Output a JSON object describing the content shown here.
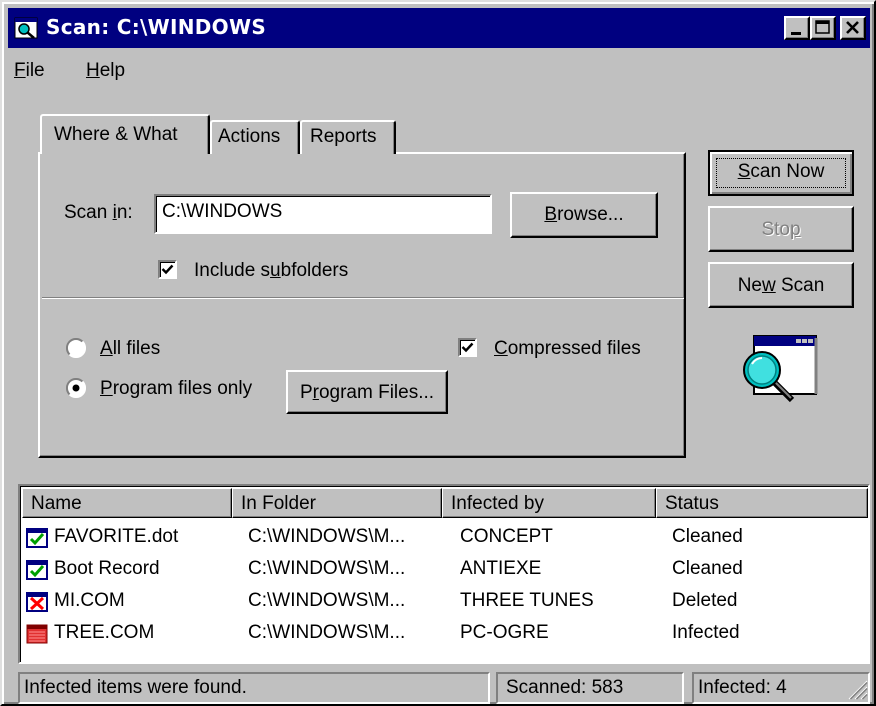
{
  "window": {
    "title": "Scan: C:\\WINDOWS",
    "minimize_icon": "minimize-icon",
    "maximize_icon": "maximize-icon",
    "close_icon": "close-icon"
  },
  "menu": {
    "items": [
      {
        "label_mnemonic": "F",
        "label_rest": "ile"
      },
      {
        "label_mnemonic": "H",
        "label_rest": "elp"
      }
    ]
  },
  "tabs": [
    {
      "label": "Where & What",
      "active": true
    },
    {
      "label": "Actions",
      "active": false
    },
    {
      "label": "Reports",
      "active": false
    }
  ],
  "where_what": {
    "scan_in_label_a": "Scan ",
    "scan_in_label_mn": "i",
    "scan_in_label_b": "n:",
    "scan_in_value": "C:\\WINDOWS",
    "browse_label_mn": "B",
    "browse_label_rest": "rowse...",
    "include_subfolders_a": "Include s",
    "include_subfolders_mn": "u",
    "include_subfolders_b": "bfolders",
    "include_subfolders_checked": true,
    "all_files_mn": "A",
    "all_files_rest": "ll files",
    "all_files_selected": false,
    "program_files_only_mn": "P",
    "program_files_only_rest": "rogram files only",
    "program_files_only_selected": true,
    "program_files_button_mn": "r",
    "program_files_button_a": "P",
    "program_files_button_b": "ogram Files...",
    "compressed_files_mn": "C",
    "compressed_files_rest": "ompressed files",
    "compressed_files_checked": true
  },
  "buttons": {
    "scan_now_mn": "S",
    "scan_now_rest": "can Now",
    "stop_a": "Sto",
    "stop_mn": "p",
    "new_scan_a": "Ne",
    "new_scan_mn": "w",
    "new_scan_b": " Scan"
  },
  "list": {
    "columns": [
      "Name",
      "In Folder",
      "Infected by",
      "Status"
    ],
    "rows": [
      {
        "name": "FAVORITE.dot",
        "folder": "C:\\WINDOWS\\M...",
        "infected_by": "CONCEPT",
        "status": "Cleaned",
        "icon": "cleaned-check-icon"
      },
      {
        "name": "Boot Record",
        "folder": "C:\\WINDOWS\\M...",
        "infected_by": "ANTIEXE",
        "status": "Cleaned",
        "icon": "cleaned-check-icon"
      },
      {
        "name": "MI.COM",
        "folder": "C:\\WINDOWS\\M...",
        "infected_by": "THREE TUNES",
        "status": "Deleted",
        "icon": "deleted-x-icon"
      },
      {
        "name": "TREE.COM",
        "folder": "C:\\WINDOWS\\M...",
        "infected_by": "PC-OGRE",
        "status": "Infected",
        "icon": "infected-file-icon"
      }
    ]
  },
  "statusbar": {
    "message": "Infected items were found.",
    "scanned": "Scanned: 583",
    "infected": "Infected: 4"
  },
  "colors": {
    "titlebar": "#000080",
    "face": "#c0c0c0",
    "check_green": "#00a000",
    "delete_red": "#ff0000",
    "infected_red": "#e03030"
  }
}
